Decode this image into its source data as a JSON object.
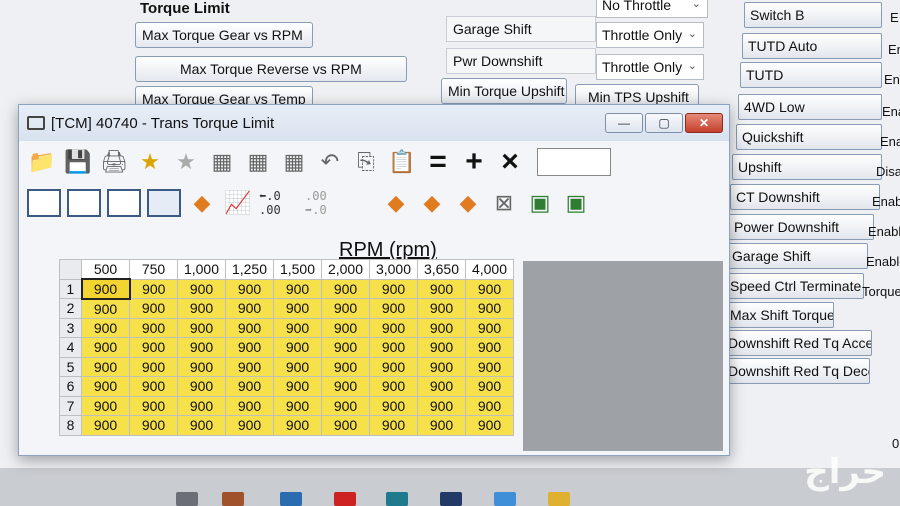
{
  "background": {
    "section_title": "Torque Limit",
    "buttons": [
      "Max Torque Gear vs RPM",
      "Max Torque Reverse vs RPM",
      "Max Torque Gear vs Temp"
    ],
    "top_clipped_label": "No Throttle",
    "rows": [
      {
        "label": "Garage Shift",
        "value": "Throttle Only"
      },
      {
        "label": "Pwr Downshift",
        "value": "Throttle Only"
      }
    ],
    "min_buttons": [
      "Min Torque Upshift",
      "Min TPS Upshift"
    ]
  },
  "right_column": {
    "items": [
      {
        "label": "Switch B",
        "value": "E"
      },
      {
        "label": "TUTD Auto",
        "value": "En"
      },
      {
        "label": "TUTD",
        "value": "Ena"
      },
      {
        "label": "4WD Low",
        "value": "Ena"
      },
      {
        "label": "Quickshift",
        "value": "Ena"
      },
      {
        "label": "Upshift",
        "value": "Disa"
      },
      {
        "label": "CT Downshift",
        "value": "Enab"
      },
      {
        "label": "Power Downshift",
        "value": "Enabl"
      },
      {
        "label": "Garage Shift",
        "value": "Enable"
      },
      {
        "label": "Speed Ctrl Terminate",
        "value": "Torque"
      }
    ],
    "extra_buttons": [
      "Max Shift Torque",
      "Downshift Red Tq Accel",
      "Downshift Red Tq Decel"
    ],
    "bottom_value": "0"
  },
  "window": {
    "title": "[TCM] 40740 - Trans Torque Limit",
    "controls": {
      "minimize": "—",
      "maximize": "▢",
      "close": "✕"
    },
    "toolbar_icons": [
      "open-icon",
      "save-icon",
      "print-icon",
      "favorite-add-icon",
      "favorite-icon",
      "table-icon",
      "table-rows-icon",
      "table-cols-icon",
      "undo-icon",
      "copy-icon",
      "paste-icon",
      "equals-icon",
      "plus-icon",
      "multiply-icon"
    ],
    "toolbar_ops": {
      "equals": "=",
      "plus": "+",
      "multiply": "×"
    },
    "decimal_controls": {
      "increase": "⬅.0 .00",
      "decrease": ".00 ➡.0"
    },
    "axis_title": "RPM (rpm)",
    "columns": [
      "500",
      "750",
      "1,000",
      "1,250",
      "1,500",
      "2,000",
      "3,000",
      "3,650",
      "4,000"
    ],
    "rows": [
      {
        "label": "1",
        "values": [
          "900",
          "900",
          "900",
          "900",
          "900",
          "900",
          "900",
          "900",
          "900"
        ]
      },
      {
        "label": "2",
        "values": [
          "900",
          "900",
          "900",
          "900",
          "900",
          "900",
          "900",
          "900",
          "900"
        ]
      },
      {
        "label": "3",
        "values": [
          "900",
          "900",
          "900",
          "900",
          "900",
          "900",
          "900",
          "900",
          "900"
        ]
      },
      {
        "label": "4",
        "values": [
          "900",
          "900",
          "900",
          "900",
          "900",
          "900",
          "900",
          "900",
          "900"
        ]
      },
      {
        "label": "5",
        "values": [
          "900",
          "900",
          "900",
          "900",
          "900",
          "900",
          "900",
          "900",
          "900"
        ]
      },
      {
        "label": "6",
        "values": [
          "900",
          "900",
          "900",
          "900",
          "900",
          "900",
          "900",
          "900",
          "900"
        ]
      },
      {
        "label": "7",
        "values": [
          "900",
          "900",
          "900",
          "900",
          "900",
          "900",
          "900",
          "900",
          "900"
        ]
      },
      {
        "label": "8",
        "values": [
          "900",
          "900",
          "900",
          "900",
          "900",
          "900",
          "900",
          "900",
          "900"
        ]
      }
    ]
  },
  "watermark": "حراج",
  "colors": {
    "cell_fill": "#f7e14b",
    "window_border": "#8da2c0",
    "close_button": "#c5402c"
  }
}
